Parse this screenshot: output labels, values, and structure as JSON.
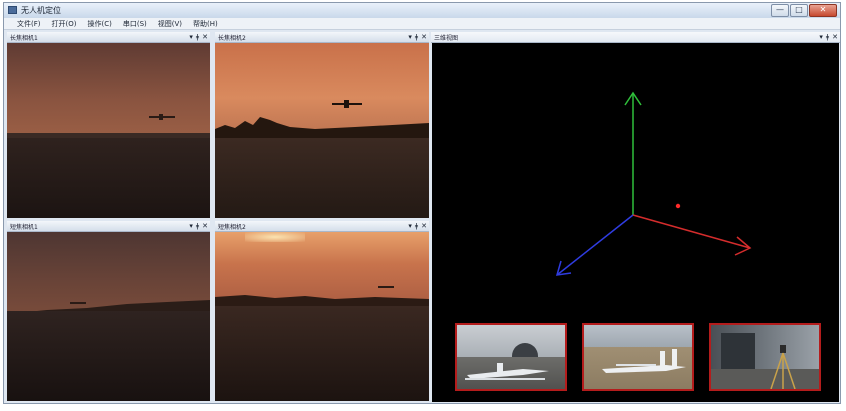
{
  "window": {
    "title": "无人机定位",
    "icon": "app-icon",
    "buttons": {
      "minimize": "—",
      "maximize": "□",
      "close": "✕"
    }
  },
  "menubar": {
    "items": [
      {
        "label": "文件(F)"
      },
      {
        "label": "打开(O)"
      },
      {
        "label": "操作(C)"
      },
      {
        "label": "串口(S)"
      },
      {
        "label": "视图(V)"
      },
      {
        "label": "帮助(H)"
      }
    ]
  },
  "panes": {
    "cam1": {
      "title": "长焦相机1"
    },
    "cam2": {
      "title": "长焦相机2"
    },
    "cam3": {
      "title": "短焦相机1"
    },
    "cam4": {
      "title": "短焦相机2"
    },
    "view3d": {
      "title": "三维视图"
    },
    "controls": {
      "dropdown": "▾",
      "pin": "ǂ",
      "close": "✕"
    }
  },
  "colors": {
    "axis_x": "#d42c2c",
    "axis_y": "#2fbf3a",
    "axis_z": "#2f3ce0",
    "target_point": "#ff2a2a",
    "thumb_border": "#b41c1c"
  },
  "icons": {
    "aircraft": "aircraft-silhouette-icon"
  }
}
